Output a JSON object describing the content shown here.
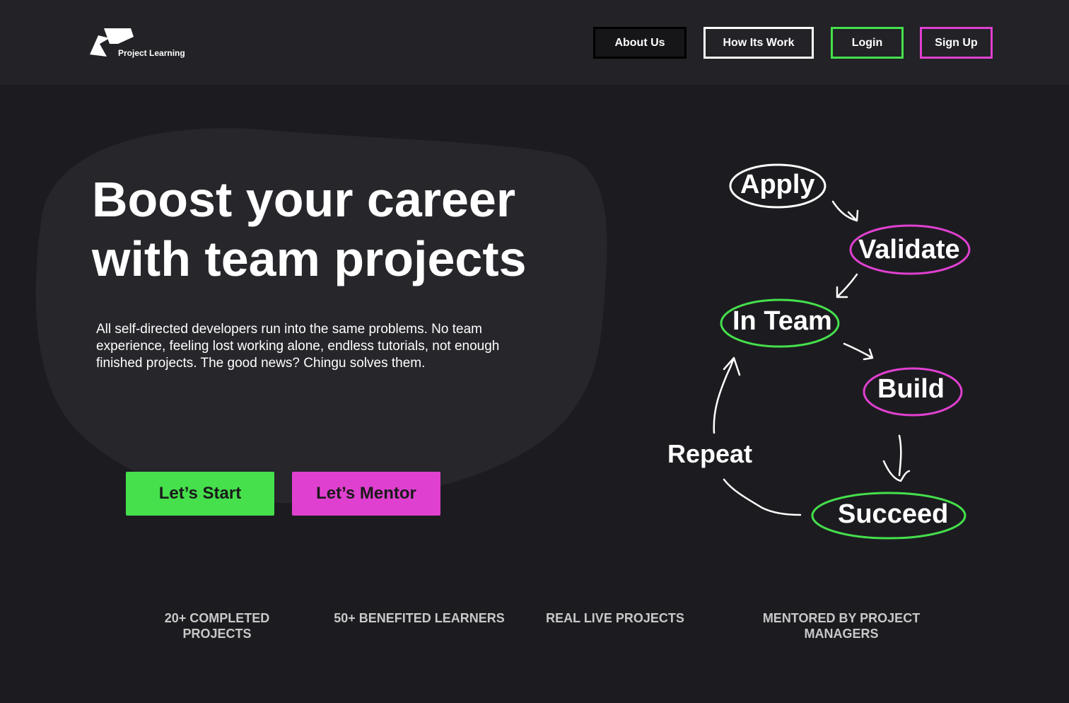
{
  "header": {
    "logo_text": "Project Learning",
    "nav": {
      "about": "About Us",
      "how": "How Its Work",
      "login": "Login",
      "signup": "Sign Up"
    }
  },
  "hero": {
    "headline_line1": "Boost your career",
    "headline_line2": "with team projects",
    "intro": "All self-directed developers run into the same problems. No team experience, feeling lost working alone, endless tutorials, not enough finished projects. The good news? Chingu solves them.",
    "cta_start": "Let’s Start",
    "cta_mentor": "Let’s Mentor"
  },
  "cycle": {
    "apply": "Apply",
    "validate": "Validate",
    "in_team": "In Team",
    "build": "Build",
    "repeat": "Repeat",
    "succeed": "Succeed"
  },
  "stats": [
    "20+ COMPLETED PROJECTS",
    "50+ BENEFITED LEARNERS",
    "REAL LIVE PROJECTS",
    "MENTORED BY PROJECT MANAGERS"
  ],
  "colors": {
    "background": "#1c1c20",
    "header": "#222227",
    "blob": "#26262b",
    "green": "#45e04c",
    "magenta": "#e040d0",
    "white": "#ffffff"
  }
}
